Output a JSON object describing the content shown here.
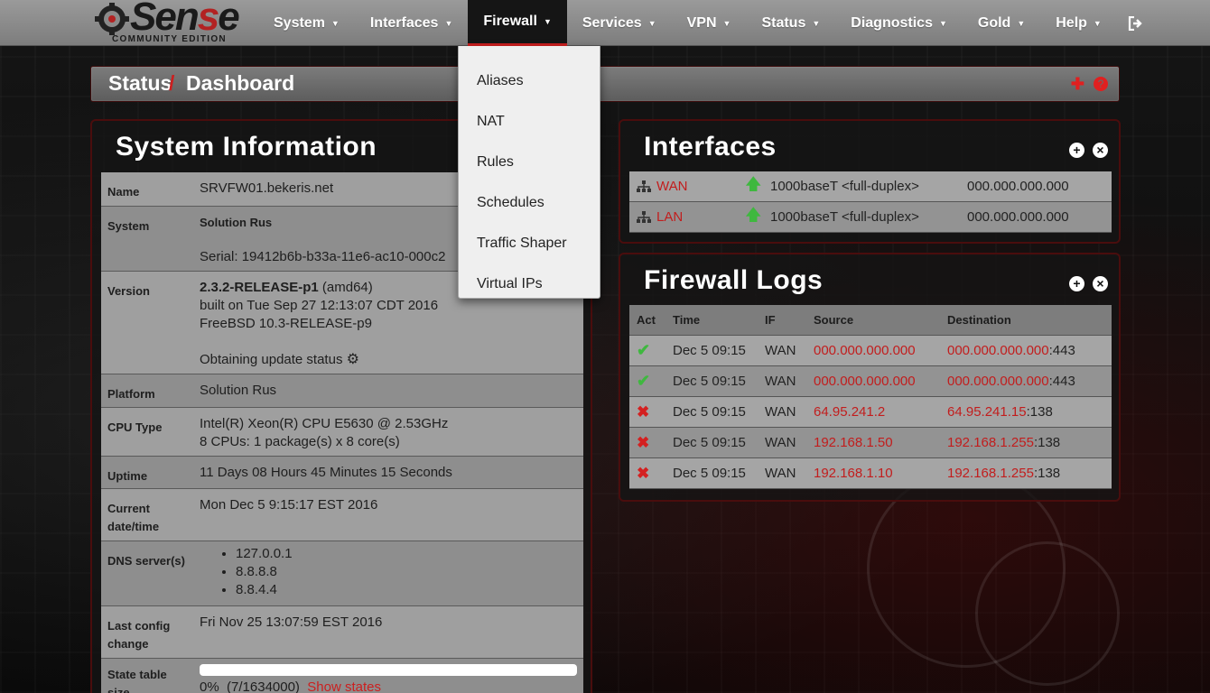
{
  "brand": {
    "name_dark": "Sen",
    "name_red": "s",
    "name_end": "e",
    "subtitle": "COMMUNITY EDITION"
  },
  "nav": [
    {
      "label": "System"
    },
    {
      "label": "Interfaces"
    },
    {
      "label": "Firewall"
    },
    {
      "label": "Services"
    },
    {
      "label": "VPN"
    },
    {
      "label": "Status"
    },
    {
      "label": "Diagnostics"
    },
    {
      "label": "Gold"
    },
    {
      "label": "Help"
    }
  ],
  "firewall_menu": [
    {
      "label": "Aliases"
    },
    {
      "label": "NAT"
    },
    {
      "label": "Rules"
    },
    {
      "label": "Schedules"
    },
    {
      "label": "Traffic Shaper"
    },
    {
      "label": "Virtual IPs"
    }
  ],
  "breadcrumb": {
    "parent": "Status",
    "separator": "/",
    "current": "Dashboard"
  },
  "system_info": {
    "title": "System Information",
    "rows": {
      "name": {
        "label": "Name",
        "value": "SRVFW01.bekeris.net"
      },
      "system": {
        "label": "System",
        "value": "Solution Rus",
        "serial_label": "Serial:",
        "serial": "19412b6b-b33a-11e6-ac10-000c2"
      },
      "version": {
        "label": "Version",
        "release": "2.3.2-RELEASE-p1",
        "arch": "(amd64)",
        "built": "built on Tue Sep 27 12:13:07 CDT 2016",
        "freebsd": "FreeBSD 10.3-RELEASE-p9",
        "update": "Obtaining update status"
      },
      "platform": {
        "label": "Platform",
        "value": "Solution Rus"
      },
      "cpu": {
        "label": "CPU Type",
        "model": "Intel(R) Xeon(R) CPU E5630 @ 2.53GHz",
        "cores": "8 CPUs: 1 package(s) x 8 core(s)"
      },
      "uptime": {
        "label": "Uptime",
        "value": "11 Days 08 Hours 45 Minutes 15 Seconds"
      },
      "datetime": {
        "label_1": "Current",
        "label_2": "date/time",
        "value": "Mon Dec 5 9:15:17 EST 2016"
      },
      "dns": {
        "label": "DNS server(s)",
        "servers": [
          "127.0.0.1",
          "8.8.8.8",
          "8.8.4.4"
        ]
      },
      "lastconfig": {
        "label_1": "Last config",
        "label_2": "change",
        "value": "Fri Nov 25 13:07:59 EST 2016"
      },
      "state": {
        "label_1": "State table",
        "label_2": "size",
        "percent_text": "0%",
        "count": "(7/1634000)",
        "link": "Show states",
        "fill_fraction": 0.0
      }
    }
  },
  "interfaces": {
    "title": "Interfaces",
    "rows": [
      {
        "name": "WAN",
        "speed": "1000baseT <full-duplex>",
        "ip": "000.000.000.000"
      },
      {
        "name": "LAN",
        "speed": "1000baseT <full-duplex>",
        "ip": "000.000.000.000"
      }
    ]
  },
  "logs": {
    "title": "Firewall Logs",
    "headers": {
      "act": "Act",
      "time": "Time",
      "if": "IF",
      "src": "Source",
      "dst": "Destination"
    },
    "rows": [
      {
        "act": "pass",
        "time": "Dec 5 09:15",
        "if": "WAN",
        "src": "000.000.000.000",
        "dst": "000.000.000.000",
        "port": ":443"
      },
      {
        "act": "pass",
        "time": "Dec 5 09:15",
        "if": "WAN",
        "src": "000.000.000.000",
        "dst": "000.000.000.000",
        "port": ":443"
      },
      {
        "act": "block",
        "time": "Dec 5 09:15",
        "if": "WAN",
        "src": "64.95.241.2",
        "dst": "64.95.241.15",
        "port": ":138"
      },
      {
        "act": "block",
        "time": "Dec 5 09:15",
        "if": "WAN",
        "src": "192.168.1.50",
        "dst": "192.168.1.255",
        "port": ":138"
      },
      {
        "act": "block",
        "time": "Dec 5 09:15",
        "if": "WAN",
        "src": "192.168.1.10",
        "dst": "192.168.1.255",
        "port": ":138"
      }
    ]
  },
  "colors": {
    "accent": "#cc1f1f",
    "pass": "#3fb83f"
  }
}
